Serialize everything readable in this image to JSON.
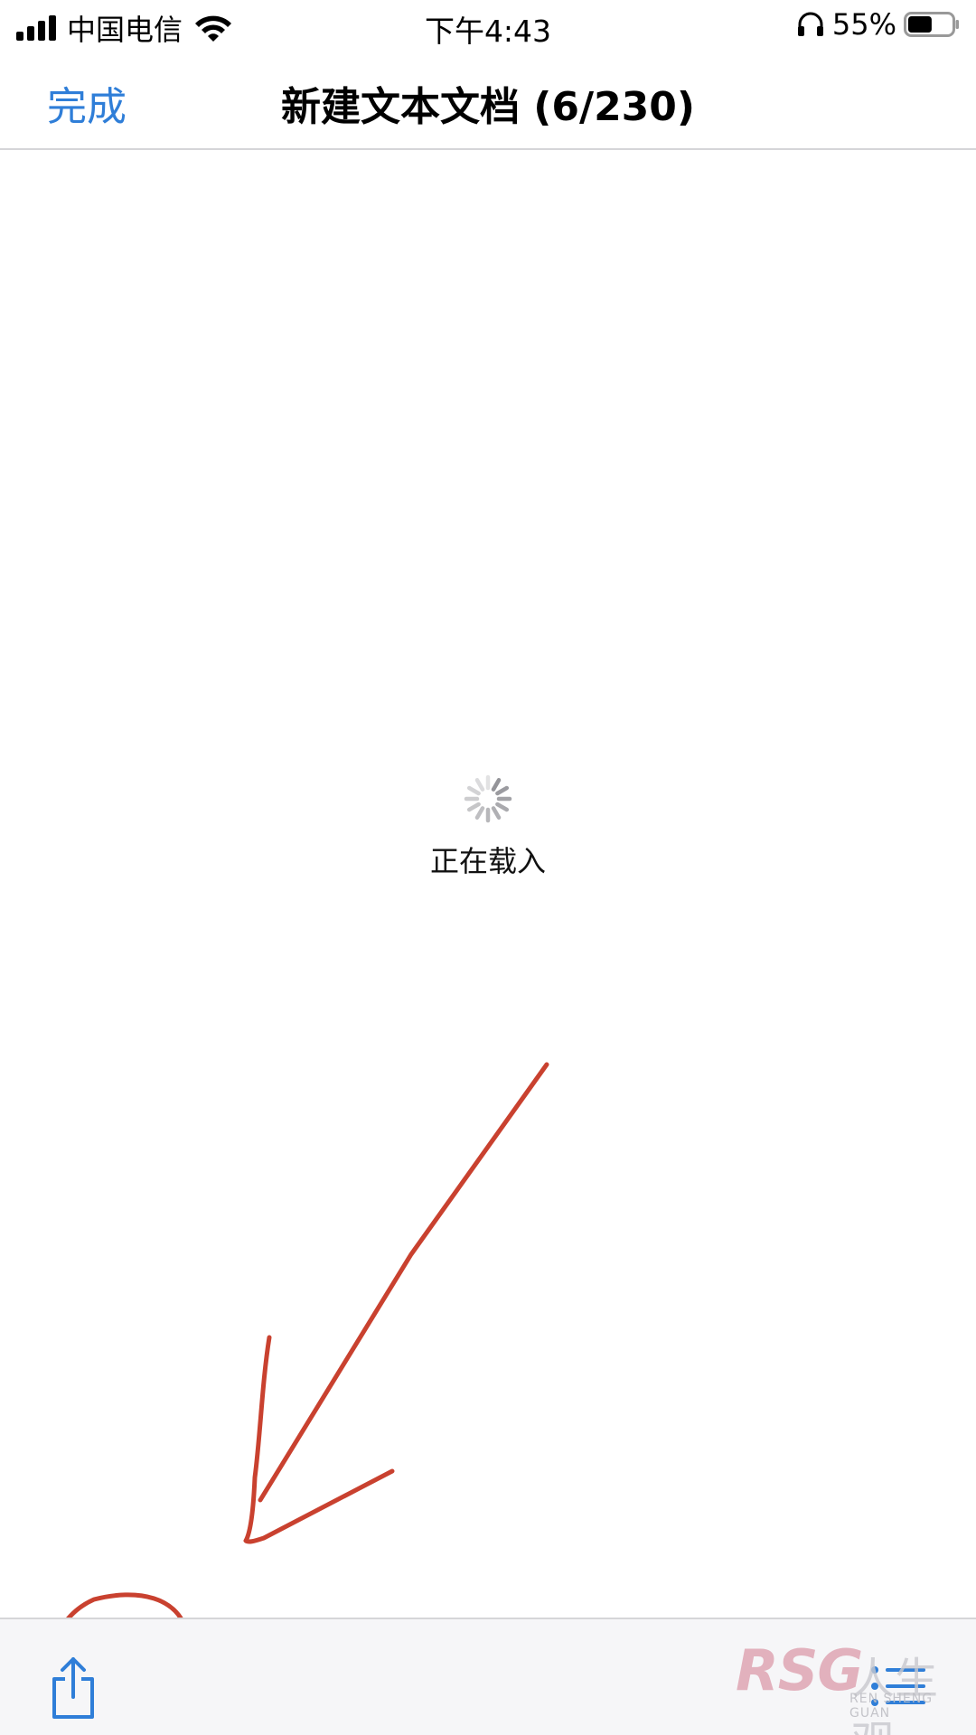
{
  "status_bar": {
    "carrier": "中国电信",
    "time": "下午4:43",
    "battery_percent": "55%",
    "battery_level": 0.55,
    "icons": [
      "signal-icon",
      "wifi-icon",
      "headphones-icon",
      "battery-icon"
    ]
  },
  "nav": {
    "done_label": "完成",
    "title": "新建文本文档 (6/230)"
  },
  "loading": {
    "text": "正在载入",
    "icon": "spinner-icon"
  },
  "toolbar": {
    "icons": [
      "share-icon",
      "list-icon"
    ]
  },
  "watermark": {
    "main": "RSG",
    "cn": "人生观",
    "sub": "REN SHENG GUAN"
  },
  "colors": {
    "accent": "#2f7ed8",
    "annotation": "#c9412f",
    "toolbar_bg": "#f6f6f8"
  }
}
